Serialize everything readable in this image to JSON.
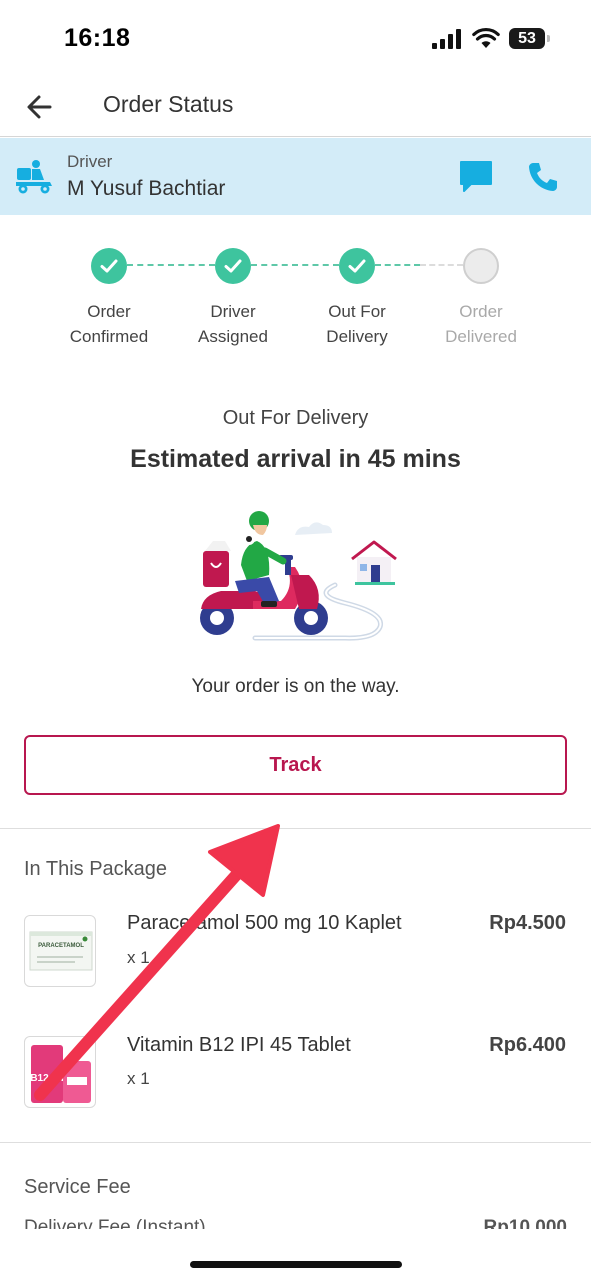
{
  "status_bar": {
    "time": "16:18",
    "battery": "53"
  },
  "header": {
    "title": "Order Status",
    "back_icon": "arrow-left-icon"
  },
  "driver": {
    "label": "Driver",
    "name": "M Yusuf Bachtiar",
    "icons": [
      "delivery-scooter-icon",
      "chat-icon",
      "phone-icon"
    ]
  },
  "progress": {
    "steps": [
      {
        "line1": "Order",
        "line2": "Confirmed",
        "done": true
      },
      {
        "line1": "Driver",
        "line2": "Assigned",
        "done": true
      },
      {
        "line1": "Out For",
        "line2": "Delivery",
        "done": true
      },
      {
        "line1": "Order",
        "line2": "Delivered",
        "done": false
      }
    ]
  },
  "delivery": {
    "status": "Out For Delivery",
    "eta": "Estimated arrival in 45 mins",
    "message": "Your order is on the way.",
    "track_label": "Track"
  },
  "package": {
    "title": "In This Package",
    "items": [
      {
        "name": "Paracetamol 500 mg 10 Kaplet",
        "qty": "x 1",
        "price": "Rp4.500",
        "thumb_text": "PARACETAMOL"
      },
      {
        "name": "Vitamin B12 IPI 45 Tablet",
        "qty": "x 1",
        "price": "Rp6.400",
        "thumb_text": "B12 IPI"
      }
    ]
  },
  "fees": {
    "title": "Service Fee",
    "delivery_label": "Delivery Fee (Instant)",
    "delivery_value": "Rp10.000"
  },
  "colors": {
    "accent": "#b8174f",
    "success": "#3ec49e",
    "driver_bar": "#d3ecf8",
    "icon_blue": "#16aee0",
    "annotation_arrow": "#f0334d"
  }
}
